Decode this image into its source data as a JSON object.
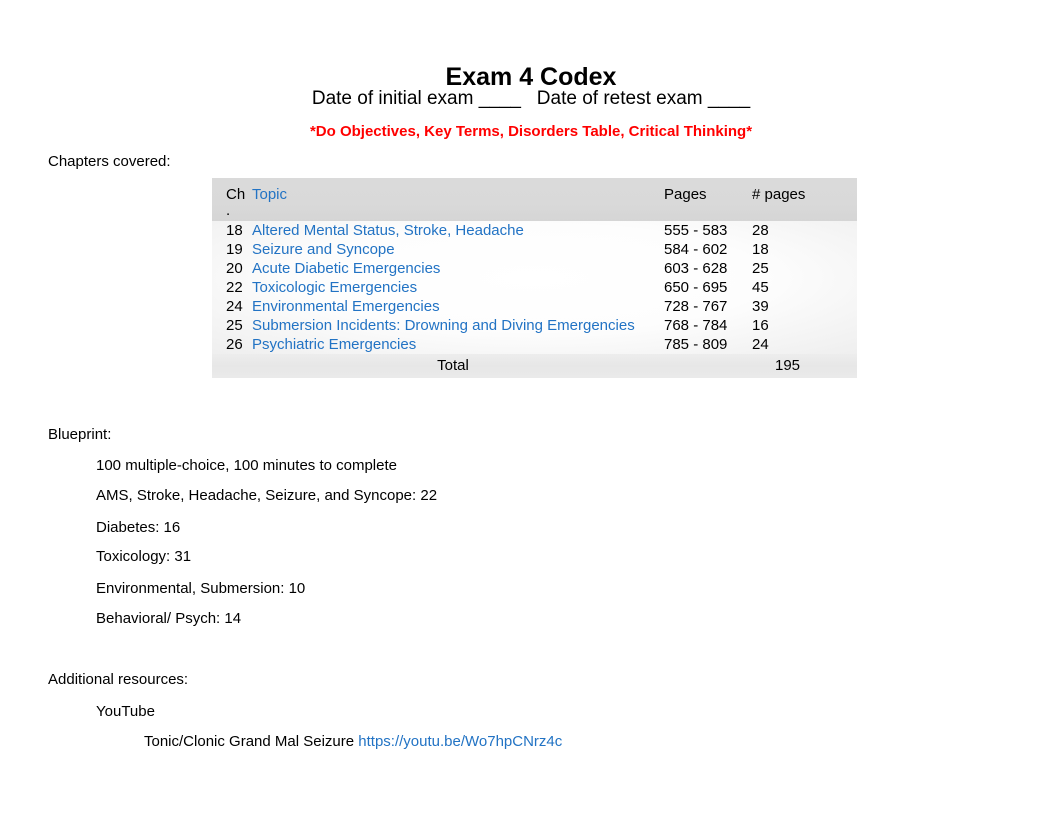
{
  "document": {
    "title": "Exam 4 Codex",
    "date_line": "Date of initial exam ____   Date of retest exam ____",
    "instruction_note": "*Do Objectives, Key Terms, Disorders Table, Critical Thinking*",
    "note_color": "#ff0000",
    "link_color": "#2273c4"
  },
  "chapters_section": {
    "label": "Chapters covered:",
    "table": {
      "headers": {
        "ch": "Ch",
        "ch_sub": ".",
        "topic": "Topic",
        "pages": "Pages",
        "num_pages": "# pages"
      },
      "rows": [
        {
          "ch": "18",
          "topic": "Altered Mental Status, Stroke, Headache",
          "pages": "555 - 583",
          "num_pages": "28"
        },
        {
          "ch": "19",
          "topic": "Seizure and Syncope",
          "pages": "584 - 602",
          "num_pages": "18"
        },
        {
          "ch": "20",
          "topic": "Acute Diabetic Emergencies",
          "pages": "603 - 628",
          "num_pages": "25"
        },
        {
          "ch": "22",
          "topic": "Toxicologic Emergencies",
          "pages": "650 - 695",
          "num_pages": "45"
        },
        {
          "ch": "24",
          "topic": "Environmental Emergencies",
          "pages": "728 - 767",
          "num_pages": "39"
        },
        {
          "ch": "25",
          "topic": "Submersion Incidents: Drowning and Diving Emergencies",
          "pages": "768 - 784",
          "num_pages": "16"
        },
        {
          "ch": "26",
          "topic": "Psychiatric Emergencies",
          "pages": "785 - 809",
          "num_pages": "24"
        }
      ],
      "total": {
        "label": "Total",
        "value": "195"
      }
    }
  },
  "blueprint_section": {
    "label": "Blueprint:",
    "items": [
      "100 multiple-choice, 100 minutes to complete",
      "AMS, Stroke, Headache, Seizure, and Syncope: 22",
      "Diabetes: 16",
      "Toxicology: 31",
      "Environmental, Submersion: 10",
      "Behavioral/ Psych: 14"
    ]
  },
  "resources_section": {
    "label": "Additional resources:",
    "source": "YouTube",
    "video": {
      "title": "Tonic/Clonic Grand Mal Seizure ",
      "url": "https://youtu.be/Wo7hpCNrz4c"
    }
  }
}
